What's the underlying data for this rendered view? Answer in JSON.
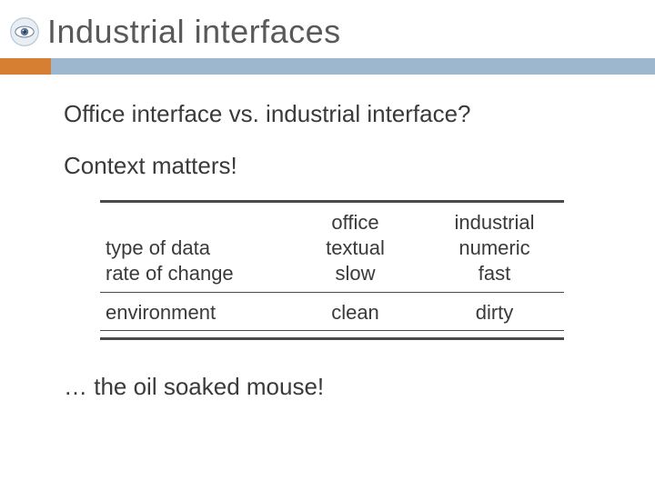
{
  "title": "Industrial interfaces",
  "subtitle": "Office interface vs. industrial interface?",
  "context_line": "Context matters!",
  "table": {
    "col1": "office",
    "col2": "industrial",
    "rows": [
      {
        "label": "type of data",
        "c1": "textual",
        "c2": "numeric"
      },
      {
        "label": "rate of change",
        "c1": "slow",
        "c2": "fast"
      },
      {
        "label": "environment",
        "c1": "clean",
        "c2": "dirty"
      }
    ]
  },
  "footer": "… the oil soaked mouse!"
}
